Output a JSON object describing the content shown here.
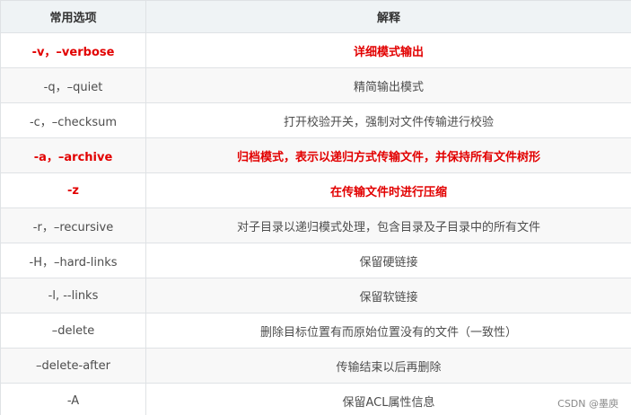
{
  "header": {
    "col1": "常用选项",
    "col2": "解释"
  },
  "rows": [
    {
      "option": "-v，–verbose",
      "description": "详细模式输出",
      "highlight": true
    },
    {
      "option": "-q，–quiet",
      "description": "精简输出模式",
      "highlight": false
    },
    {
      "option": "-c，–checksum",
      "description": "打开校验开关，强制对文件传输进行校验",
      "highlight": false
    },
    {
      "option": "-a，–archive",
      "description": "归档模式，表示以递归方式传输文件，并保持所有文件树形",
      "highlight": true
    },
    {
      "option": "-z",
      "description": "在传输文件时进行压缩",
      "highlight": true
    },
    {
      "option": "-r，–recursive",
      "description": "对子目录以递归模式处理，包含目录及子目录中的所有文件",
      "highlight": false
    },
    {
      "option": "-H，–hard-links",
      "description": "保留硬链接",
      "highlight": false
    },
    {
      "option": "-l, --links",
      "description": "保留软链接",
      "highlight": false
    },
    {
      "option": "–delete",
      "description": "删除目标位置有而原始位置没有的文件（一致性）",
      "highlight": false
    },
    {
      "option": "–delete-after",
      "description": "传输结束以后再删除",
      "highlight": false
    },
    {
      "option": "-A",
      "description": "保留ACL属性信息",
      "highlight": false
    }
  ],
  "watermark": "CSDN @墨庾",
  "colors": {
    "highlight_text": "#e20000",
    "header_bg": "#eff3f5",
    "stripe_bg": "#f8f8f8",
    "border": "#dfe2e5"
  }
}
